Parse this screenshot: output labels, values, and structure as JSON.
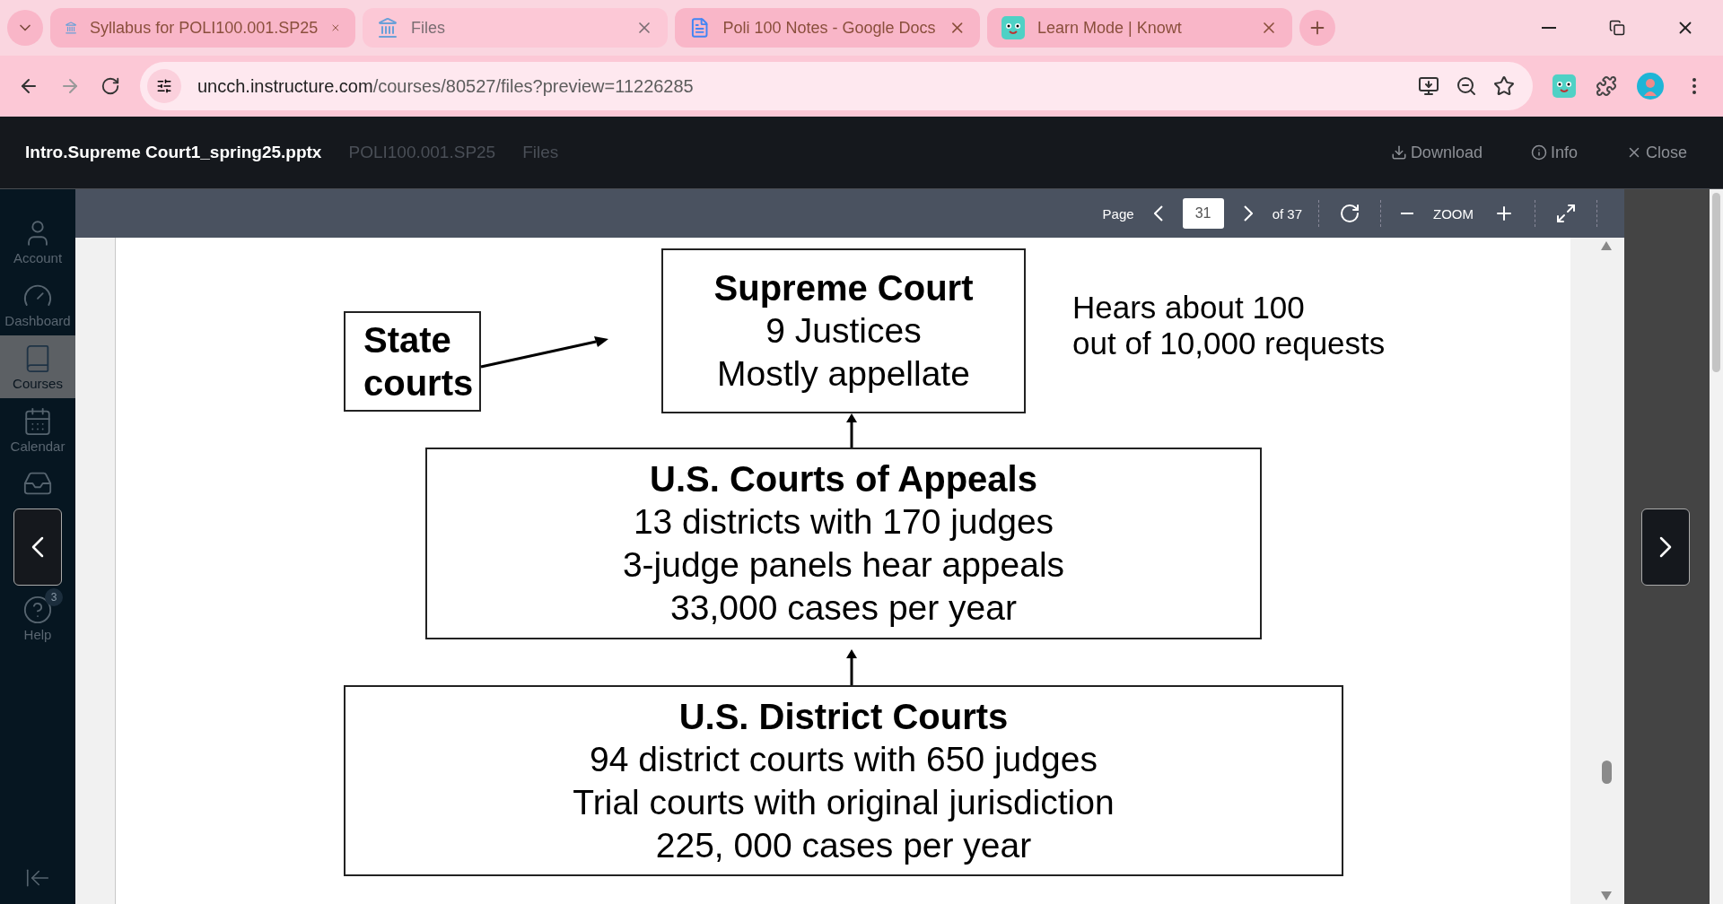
{
  "browser": {
    "tabs": [
      {
        "title": "Syllabus for POLI100.001.SP25",
        "selected": false
      },
      {
        "title": "Files",
        "selected": true
      },
      {
        "title": "Poli 100 Notes - Google Docs",
        "selected": false
      },
      {
        "title": "Learn Mode | Knowt",
        "selected": false
      }
    ],
    "url": {
      "host": "uncch.instructure.com",
      "path": "/courses/80527/files?preview=11226285"
    }
  },
  "background": {
    "breadcrumb": [
      "POLI100.001.SP25",
      "Files"
    ],
    "nav": [
      {
        "label": "Account",
        "selected": false
      },
      {
        "label": "Dashboard",
        "selected": false
      },
      {
        "label": "Courses",
        "selected": true
      },
      {
        "label": "Calendar",
        "selected": false
      },
      {
        "label": "Help",
        "selected": false,
        "badge": "3"
      }
    ]
  },
  "viewer": {
    "filename": "Intro.Supreme Court1_spring25.pptx",
    "actions": [
      "Download",
      "Info",
      "Close"
    ],
    "toolbar": {
      "page_label": "Page",
      "page": "31",
      "total": "of 37",
      "zoom_label": "ZOOM"
    }
  },
  "slide": {
    "boxes": [
      {
        "kind": "state",
        "title": "State courts"
      },
      {
        "kind": "supreme",
        "title": "Supreme Court",
        "lines": [
          "9 Justices",
          "Mostly appellate"
        ]
      },
      {
        "kind": "appeals",
        "title": "U.S. Courts of Appeals",
        "lines": [
          "13 districts with 170 judges",
          "3-judge panels hear appeals",
          "33,000 cases per year"
        ]
      },
      {
        "kind": "district",
        "title": "U.S. District Courts",
        "lines": [
          "94 district courts with 650 judges",
          "Trial courts with original jurisdiction",
          "225, 000 cases per year"
        ]
      }
    ],
    "note": [
      "Hears about 100",
      "out of 10,000 requests"
    ]
  }
}
